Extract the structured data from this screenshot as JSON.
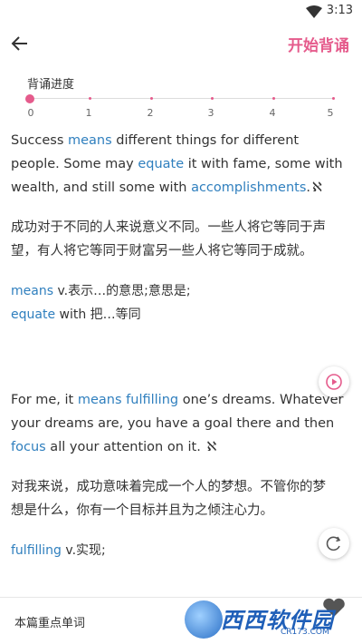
{
  "status": {
    "time": "3:13"
  },
  "header": {
    "start_label": "开始背诵"
  },
  "progress": {
    "title": "背诵进度",
    "ticks": [
      "0",
      "1",
      "2",
      "3",
      "4",
      "5"
    ],
    "current": 0
  },
  "section1": {
    "en": [
      "Success ",
      "means",
      " different things for different people. Some may ",
      "equate",
      " it with fame, some with wealth, and still some with ",
      "accomplishments",
      "."
    ],
    "aleph": "ℵ",
    "zh": "成功对于不同的人来说意义不同。一些人将它等同于声望，有人将它等同于财富另一些人将它等同于成就。",
    "vocab": [
      {
        "word": "means",
        "def": " v.表示…的意思;意思是;"
      },
      {
        "word": "equate",
        "def": " with 把…等同"
      }
    ]
  },
  "section2": {
    "en": [
      "For me, it ",
      "means",
      " ",
      "fulfilling",
      " one’s dreams. Whatever your dreams are, you have a goal there and then ",
      "focus",
      " all your attention on it. "
    ],
    "aleph": "ℵ",
    "zh": "对我来说，成功意味着完成一个人的梦想。不管你的梦想是什么，你有一个目标并且为之倾注心力。",
    "vocab": [
      {
        "word": "fulfilling",
        "def": " v.实现;"
      }
    ]
  },
  "footer": {
    "label": "本篇重点单词"
  },
  "watermark": {
    "text": "西西软件园",
    "sub": "CR173.COM"
  },
  "colors": {
    "accent": "#e55b8c",
    "keyword": "#2f7fbe"
  }
}
